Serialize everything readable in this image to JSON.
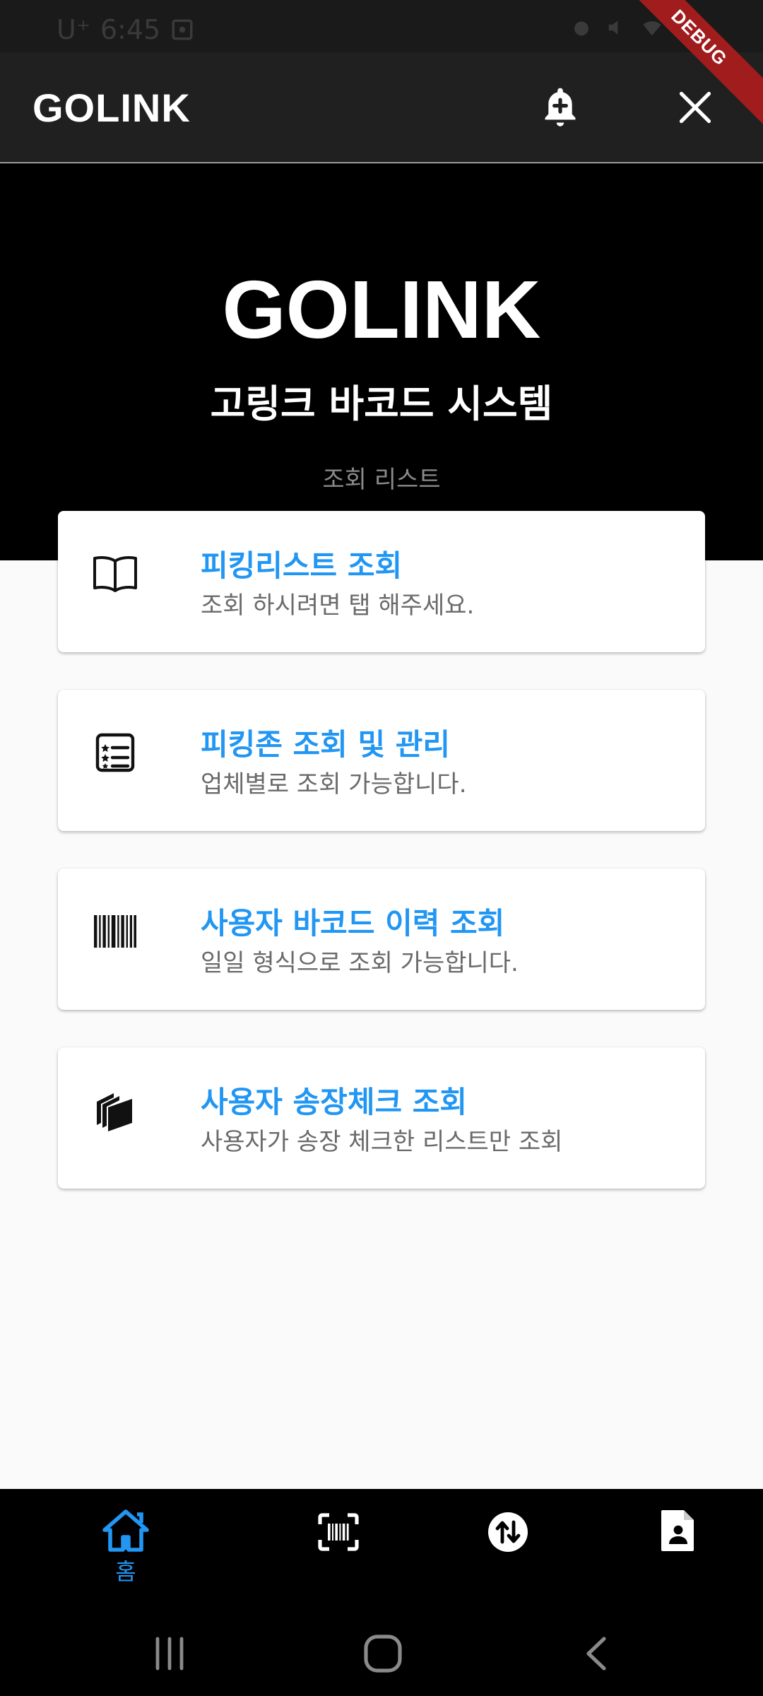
{
  "status_bar": {
    "carrier": "U⁺",
    "time": "6:45"
  },
  "app_bar": {
    "title": "GOLINK"
  },
  "debug_banner": "DEBUG",
  "hero": {
    "title": "GOLINK",
    "subtitle": "고링크 바코드 시스템",
    "caption": "조회 리스트"
  },
  "cards": [
    {
      "icon": "open-book-icon",
      "title": "피킹리스트 조회",
      "subtitle": "조회 하시려면 탭 해주세요."
    },
    {
      "icon": "star-list-icon",
      "title": "피킹존 조회 및 관리",
      "subtitle": "업체별로 조회 가능합니다."
    },
    {
      "icon": "barcode-icon",
      "title": "사용자 바코드 이력 조회",
      "subtitle": "일일 형식으로 조회 가능합니다."
    },
    {
      "icon": "documents-stack-icon",
      "title": "사용자 송장체크 조회",
      "subtitle": "사용자가 송장 체크한 리스트만 조회"
    }
  ],
  "bottom_nav": {
    "items": [
      {
        "icon": "home-icon",
        "label": "홈",
        "active": true
      },
      {
        "icon": "barcode-scan-icon",
        "label": "",
        "active": false
      },
      {
        "icon": "swap-vertical-icon",
        "label": "",
        "active": false
      },
      {
        "icon": "person-document-icon",
        "label": "",
        "active": false
      }
    ]
  },
  "colors": {
    "accent": "#2196f3",
    "hero_bg": "#000000",
    "app_bar_bg": "#202020",
    "debug_banner": "#a11c1c"
  }
}
